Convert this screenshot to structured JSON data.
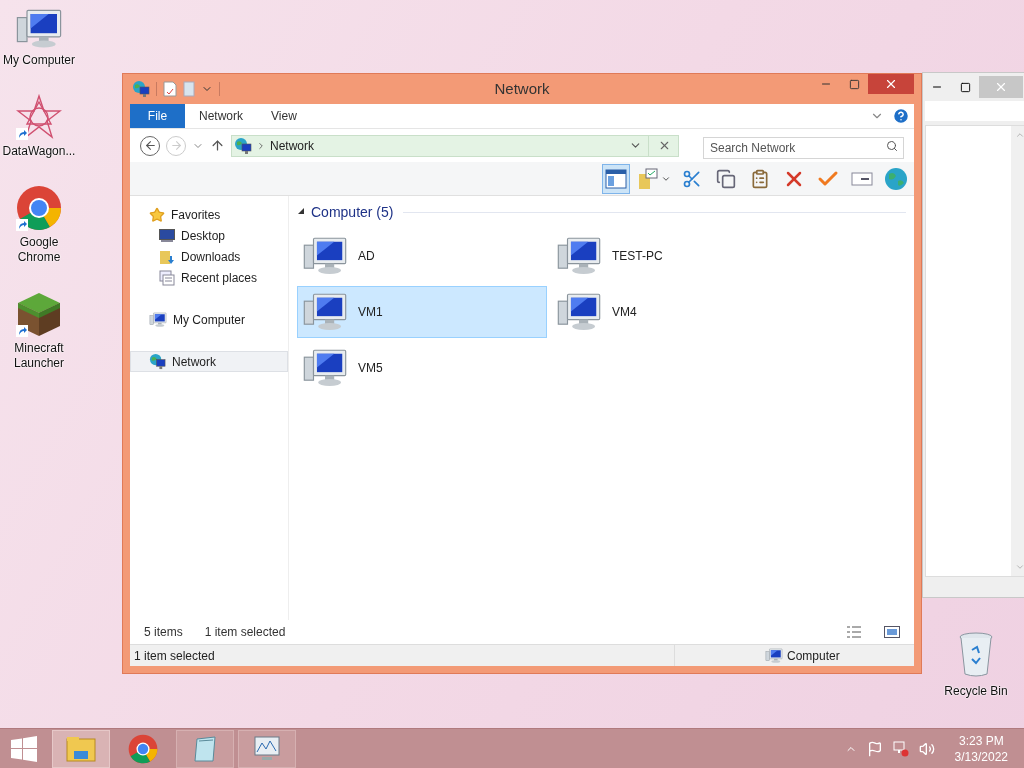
{
  "desktop_icons": [
    {
      "label": "My Computer",
      "kind": "computer",
      "shortcut": false
    },
    {
      "label": "DataWagon...",
      "kind": "star",
      "shortcut": true
    },
    {
      "label": "Google Chrome",
      "kind": "chrome",
      "shortcut": true
    },
    {
      "label": "Minecraft Launcher",
      "kind": "block",
      "shortcut": true
    }
  ],
  "recycle_bin": {
    "label": "Recycle Bin"
  },
  "window": {
    "title": "Network",
    "ribbon_tabs": [
      {
        "label": "File",
        "kind": "file"
      },
      {
        "label": "Network",
        "kind": "tab"
      },
      {
        "label": "View",
        "kind": "tab"
      }
    ],
    "address": "Network",
    "search": {
      "placeholder": "Search Network"
    },
    "toolbar": [
      {
        "kind": "preview-pane",
        "on": true
      },
      {
        "kind": "folder",
        "on": false
      },
      {
        "kind": "cut",
        "on": false
      },
      {
        "kind": "copy",
        "on": false
      },
      {
        "kind": "paste",
        "on": false
      },
      {
        "kind": "delete",
        "on": false
      },
      {
        "kind": "check",
        "on": false
      },
      {
        "kind": "rename",
        "on": false
      },
      {
        "kind": "globe",
        "on": false
      }
    ],
    "nav": [
      {
        "label": "Favorites",
        "kind": "favorites",
        "selected": false,
        "children": [
          {
            "label": "Desktop",
            "kind": "desktop",
            "selected": false
          },
          {
            "label": "Downloads",
            "kind": "downloads",
            "selected": false
          },
          {
            "label": "Recent places",
            "kind": "recent",
            "selected": false
          }
        ]
      },
      {
        "label": "My Computer",
        "kind": "computer",
        "selected": false
      },
      {
        "label": "Network",
        "kind": "network",
        "selected": true
      }
    ],
    "group": {
      "label": "Computer (5)",
      "expanded": true,
      "items": [
        {
          "label": "AD",
          "selected": false
        },
        {
          "label": "TEST-PC",
          "selected": false
        },
        {
          "label": "VM1",
          "selected": true
        },
        {
          "label": "VM4",
          "selected": false
        },
        {
          "label": "VM5",
          "selected": false
        }
      ]
    },
    "details": {
      "count": "5 items",
      "selection": "1 item selected"
    },
    "status_bar": {
      "left": "1 item selected",
      "zone": "Computer"
    }
  },
  "taskbar": {
    "buttons": [
      {
        "kind": "explorer",
        "selected": true
      },
      {
        "kind": "chrome",
        "selected": false
      },
      {
        "kind": "notepad",
        "selected": false
      },
      {
        "kind": "monitor",
        "selected": false
      }
    ],
    "time": "3:23 PM",
    "date": "3/13/2022"
  }
}
